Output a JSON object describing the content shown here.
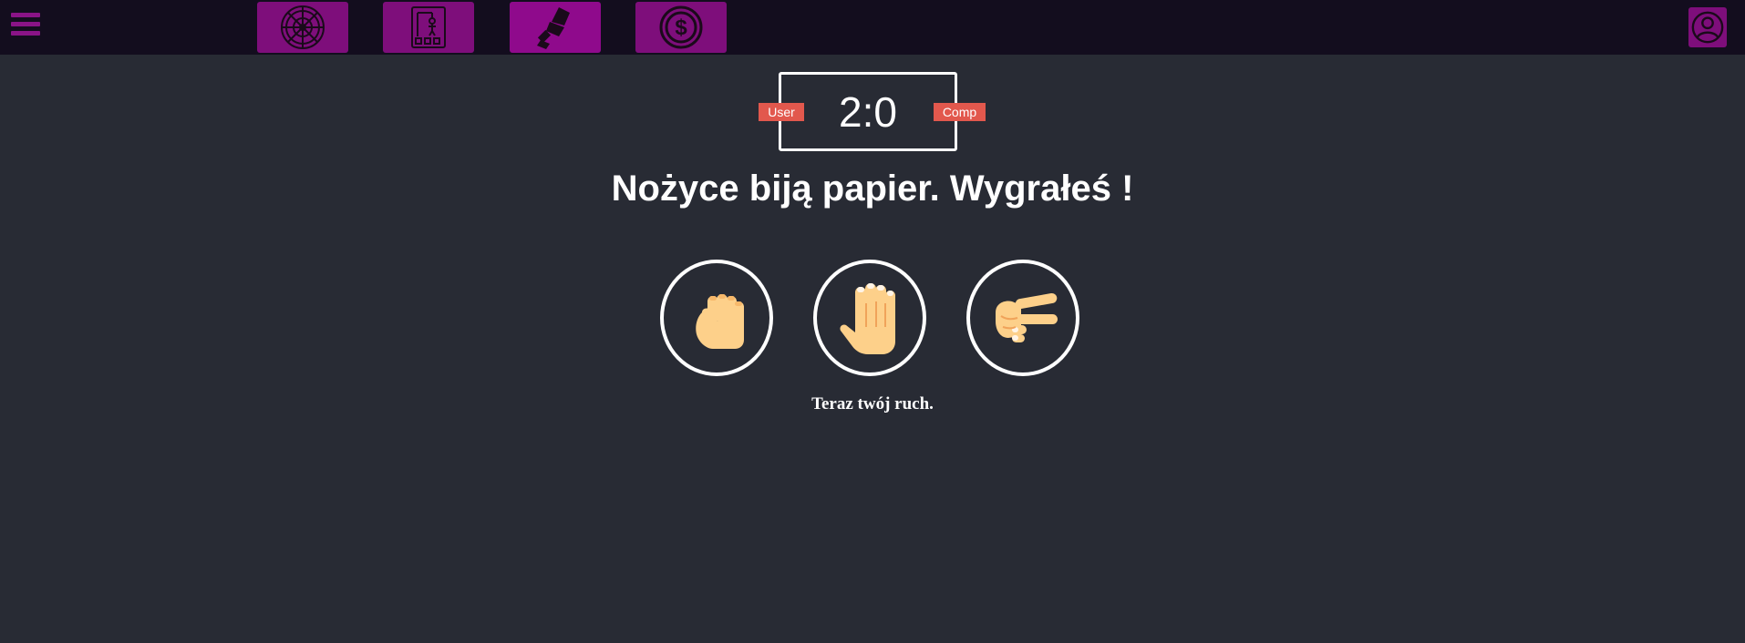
{
  "header": {
    "menu_icon": "hamburger-menu-icon",
    "games": [
      {
        "icon": "roulette-icon"
      },
      {
        "icon": "hangman-icon"
      },
      {
        "icon": "rock-paper-scissors-icon",
        "active": true
      },
      {
        "icon": "dollar-coin-icon"
      }
    ],
    "profile_icon": "user-profile-icon"
  },
  "scoreboard": {
    "score": "2:0",
    "user_label": "User",
    "comp_label": "Comp"
  },
  "result_message": "Nożyce biją papier. Wygrałeś !",
  "choices": [
    {
      "icon": "rock-fist-icon"
    },
    {
      "icon": "paper-hand-icon"
    },
    {
      "icon": "scissors-hand-icon"
    }
  ],
  "turn_message": "Teraz twój ruch.",
  "colors": {
    "background": "#282b34",
    "topbar": "#130d1e",
    "accent": "#8a1487",
    "badge": "#e2584d",
    "skin": "#fdd08a"
  }
}
